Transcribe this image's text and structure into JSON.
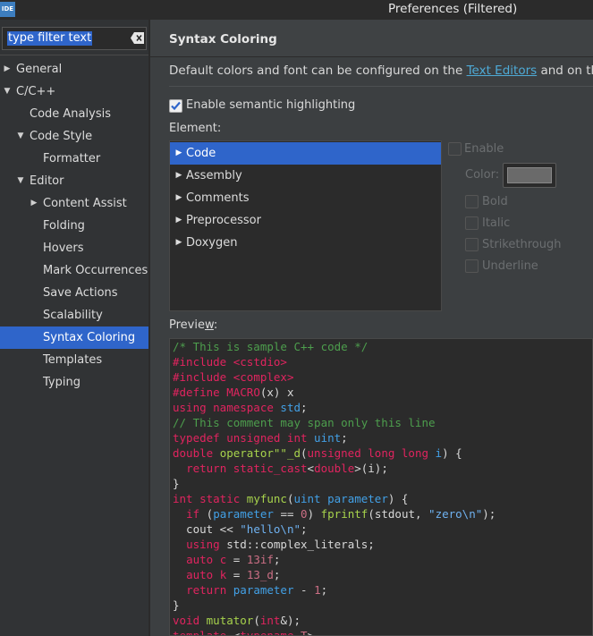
{
  "window": {
    "app_icon": "IDE",
    "title": "Preferences (Filtered)"
  },
  "filter": {
    "value": "type filter text",
    "clear_icon": "clear-icon"
  },
  "tree": [
    {
      "label": "General",
      "expanded": false,
      "has_children": true
    },
    {
      "label": "C/C++",
      "expanded": true,
      "has_children": true
    },
    {
      "label": "Code Analysis",
      "has_children": false
    },
    {
      "label": "Code Style",
      "expanded": true,
      "has_children": true
    },
    {
      "label": "Formatter",
      "has_children": false
    },
    {
      "label": "Editor",
      "expanded": true,
      "has_children": true
    },
    {
      "label": "Content Assist",
      "expanded": false,
      "has_children": true
    },
    {
      "label": "Folding",
      "has_children": false
    },
    {
      "label": "Hovers",
      "has_children": false
    },
    {
      "label": "Mark Occurrences",
      "has_children": false
    },
    {
      "label": "Save Actions",
      "has_children": false
    },
    {
      "label": "Scalability",
      "has_children": false
    },
    {
      "label": "Syntax Coloring",
      "has_children": false,
      "selected": true
    },
    {
      "label": "Templates",
      "has_children": false
    },
    {
      "label": "Typing",
      "has_children": false
    }
  ],
  "page": {
    "title": "Syntax Coloring",
    "description_before": "Default colors and font can be configured on the ",
    "description_link": "Text Editors",
    "description_after": " and on th",
    "semantic_highlighting": {
      "label": "Enable semantic highlighting",
      "checked": true
    },
    "element_label": "Element:",
    "elements": [
      {
        "label": "Code",
        "selected": true
      },
      {
        "label": "Assembly"
      },
      {
        "label": "Comments"
      },
      {
        "label": "Preprocessor"
      },
      {
        "label": "Doxygen"
      }
    ],
    "options": {
      "enable": "Enable",
      "color": "Color:",
      "bold": "Bold",
      "italic": "Italic",
      "strikethrough": "Strikethrough",
      "underline": "Underline"
    },
    "preview_label_pre": "Previe",
    "preview_label_mnemonic": "w",
    "preview_label_post": ":"
  },
  "code_lines": [
    [
      [
        "c-comment",
        "/* This is sample C++ code */"
      ]
    ],
    [
      [
        "c-kw",
        "#include"
      ],
      [
        "",
        " "
      ],
      [
        "c-kw",
        "<cstdio>"
      ]
    ],
    [
      [
        "c-kw",
        "#include"
      ],
      [
        "",
        " "
      ],
      [
        "c-kw",
        "<complex>"
      ]
    ],
    [
      [
        "c-kw",
        "#define"
      ],
      [
        "",
        " "
      ],
      [
        "c-kw",
        "MACRO"
      ],
      [
        "",
        "(x) x"
      ]
    ],
    [
      [
        "c-kw",
        "using namespace"
      ],
      [
        "",
        " "
      ],
      [
        "c-type",
        "std"
      ],
      [
        "",
        ";"
      ]
    ],
    [
      [
        "c-comment",
        "// This comment may span only this line"
      ]
    ],
    [
      [
        "c-kw",
        "typedef unsigned int"
      ],
      [
        "",
        " "
      ],
      [
        "c-type",
        "uint"
      ],
      [
        "",
        ";"
      ]
    ],
    [
      [
        "c-kw",
        "double"
      ],
      [
        "",
        " "
      ],
      [
        "c-fn",
        "operator\"\"_d"
      ],
      [
        "",
        "("
      ],
      [
        "c-kw",
        "unsigned long long"
      ],
      [
        "",
        " "
      ],
      [
        "c-type",
        "i"
      ],
      [
        "",
        ") {"
      ]
    ],
    [
      [
        "",
        "  "
      ],
      [
        "c-kw",
        "return static_cast"
      ],
      [
        "",
        "<"
      ],
      [
        "c-kw",
        "double"
      ],
      [
        "",
        ">(i);"
      ]
    ],
    [
      [
        "",
        "}"
      ]
    ],
    [
      [
        "c-kw",
        "int static"
      ],
      [
        "",
        " "
      ],
      [
        "c-fn",
        "myfunc"
      ],
      [
        "",
        "("
      ],
      [
        "c-type",
        "uint"
      ],
      [
        "",
        " "
      ],
      [
        "c-type",
        "parameter"
      ],
      [
        "",
        ") {"
      ]
    ],
    [
      [
        "",
        "  "
      ],
      [
        "c-kw",
        "if"
      ],
      [
        "",
        " ("
      ],
      [
        "c-type",
        "parameter"
      ],
      [
        "",
        " == "
      ],
      [
        "c-num",
        "0"
      ],
      [
        "",
        ") "
      ],
      [
        "c-fn",
        "fprintf"
      ],
      [
        "",
        "(stdout, "
      ],
      [
        "c-str",
        "\"zero\\n\""
      ],
      [
        "",
        ");"
      ]
    ],
    [
      [
        "",
        "  cout << "
      ],
      [
        "c-str",
        "\"hello\\n\""
      ],
      [
        "",
        ";"
      ]
    ],
    [
      [
        "",
        "  "
      ],
      [
        "c-kw",
        "using"
      ],
      [
        "",
        " std::complex_literals;"
      ]
    ],
    [
      [
        "",
        "  "
      ],
      [
        "c-kw",
        "auto"
      ],
      [
        "",
        " "
      ],
      [
        "c-kw",
        "c"
      ],
      [
        "",
        " = "
      ],
      [
        "c-num",
        "13if"
      ],
      [
        "",
        ";"
      ]
    ],
    [
      [
        "",
        "  "
      ],
      [
        "c-kw",
        "auto"
      ],
      [
        "",
        " "
      ],
      [
        "c-kw",
        "k"
      ],
      [
        "",
        " = "
      ],
      [
        "c-num",
        "13_d"
      ],
      [
        "",
        ";"
      ]
    ],
    [
      [
        "",
        "  "
      ],
      [
        "c-kw",
        "return"
      ],
      [
        "",
        " "
      ],
      [
        "c-type",
        "parameter"
      ],
      [
        "",
        " - "
      ],
      [
        "c-num",
        "1"
      ],
      [
        "",
        ";"
      ]
    ],
    [
      [
        "",
        "}"
      ]
    ],
    [
      [
        "c-kw",
        "void"
      ],
      [
        "",
        " "
      ],
      [
        "c-fn",
        "mutator"
      ],
      [
        "",
        "("
      ],
      [
        "c-kw",
        "int"
      ],
      [
        "",
        "&);"
      ]
    ],
    [
      [
        "c-kw",
        "template"
      ],
      [
        "",
        " <"
      ],
      [
        "c-kw",
        "typename"
      ],
      [
        "",
        " "
      ],
      [
        "c-num",
        "T"
      ],
      [
        "",
        ">"
      ]
    ]
  ]
}
